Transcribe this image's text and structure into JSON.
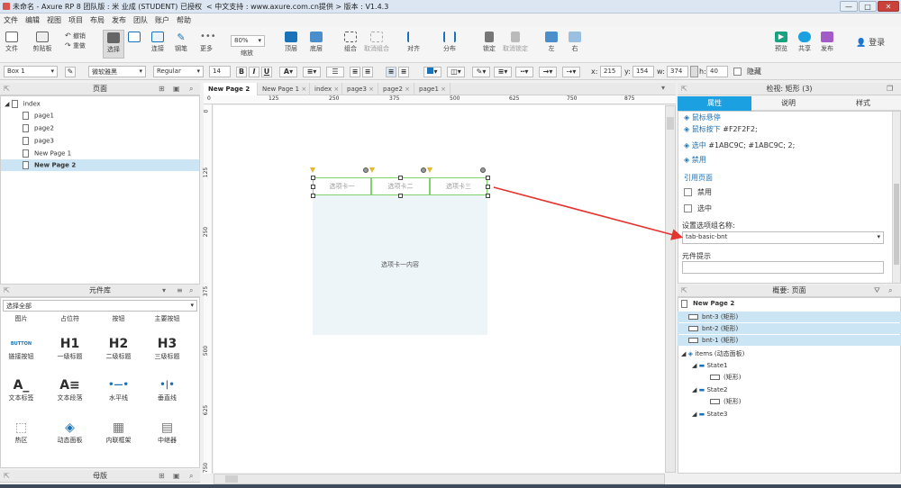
{
  "window": {
    "title": "未命名 - Axure RP 8 团队版 : 米 业成 (STUDENT) 已授权",
    "support": "< 中文支持 : www.axure.com.cn提供 > 版本 : V1.4.3",
    "watermark": "V1.4.3",
    "minimize": "—",
    "maximize": "□",
    "close": "✕"
  },
  "menu": [
    "文件",
    "编辑",
    "视图",
    "项目",
    "布局",
    "发布",
    "团队",
    "账户",
    "帮助"
  ],
  "toolbar": {
    "file": "文件",
    "clipboard": "剪贴板",
    "undo": "撤销",
    "redo": "重做",
    "select": "选择",
    "connect": "连接",
    "pen": "钢笔",
    "more": "更多",
    "zoom_value": "80%",
    "zoom_label": "缩放",
    "top": "顶层",
    "bottom": "底层",
    "group": "组合",
    "ungroup": "取消组合",
    "align": "对齐",
    "distribute": "分布",
    "lock": "锁定",
    "unlock": "取消锁定",
    "left": "左",
    "right": "右",
    "preview": "预览",
    "share": "共享",
    "publish": "发布",
    "login": "登录"
  },
  "format": {
    "style": "Box 1",
    "font": "微软雅黑",
    "weight": "Regular",
    "size": "14",
    "bold": "B",
    "italic": "I",
    "underline": "U",
    "x_label": "x:",
    "x": "215",
    "y_label": "y:",
    "y": "154",
    "w_label": "w:",
    "w": "374",
    "h_label": "h:",
    "h": "40",
    "hidden": "隐藏"
  },
  "pages_panel": {
    "title": "页面",
    "root": "index",
    "items": [
      "page1",
      "page2",
      "page3",
      "New Page 1",
      "New Page 2"
    ],
    "selected": "New Page 2"
  },
  "library_panel": {
    "title": "元件库",
    "filter": "选择全部",
    "row0": [
      "图片",
      "占位符",
      "按钮",
      "主要按钮"
    ],
    "rows": [
      {
        "glyphs": [
          "BUTTON",
          "H1",
          "H2",
          "H3"
        ],
        "labels": [
          "链接按钮",
          "一级标题",
          "二级标题",
          "三级标题"
        ]
      },
      {
        "glyphs": [
          "A_",
          "A≡",
          "•—•",
          "•|•"
        ],
        "labels": [
          "文本标签",
          "文本段落",
          "水平线",
          "垂直线"
        ]
      },
      {
        "glyphs": [
          "⬚",
          "◈",
          "▦",
          "▤"
        ],
        "labels": [
          "热区",
          "动态面板",
          "内联框架",
          "中继器"
        ]
      }
    ]
  },
  "masters_panel": {
    "title": "母版"
  },
  "tabs": [
    "New Page 2",
    "New Page 1",
    "index",
    "page3",
    "page2",
    "page1"
  ],
  "ruler": {
    "h": [
      "0",
      "125",
      "250",
      "375",
      "500",
      "625",
      "750",
      "875"
    ],
    "v": [
      "0",
      "125",
      "250",
      "375",
      "500",
      "625",
      "750"
    ]
  },
  "canvas": {
    "tab1": "选项卡一",
    "tab2": "选项卡二",
    "tab3": "选项卡三",
    "content": "选项卡一内容"
  },
  "inspector": {
    "title": "检视: 矩形 (3)",
    "tabs": [
      "属性",
      "说明",
      "样式"
    ],
    "interaction_hover": "鼠标悬停",
    "interaction_down_link": "鼠标按下",
    "interaction_down_value": "#F2F2F2;",
    "interaction_selected_link": "选中",
    "interaction_selected_value": "#1ABC9C; #1ABC9C; 2;",
    "interaction_disabled_link": "禁用",
    "ref_page": "引用页面",
    "disabled": "禁用",
    "selected": "选中",
    "group_name_label": "设置选项组名称:",
    "group_name_value": "tab-basic-bnt",
    "tooltip_label": "元件提示"
  },
  "outline": {
    "title": "概要: 页面",
    "page": "New Page 2",
    "rows": [
      "bnt-3 (矩形)",
      "bnt-2 (矩形)",
      "bnt-1 (矩形)",
      "items (动态面板)",
      "State1",
      "(矩形)",
      "State2",
      "(矩形)",
      "State3"
    ]
  },
  "colors": {
    "accent": "#1ba1e2",
    "selection_green": "#7fd36a",
    "arrow": "#e3342f"
  }
}
